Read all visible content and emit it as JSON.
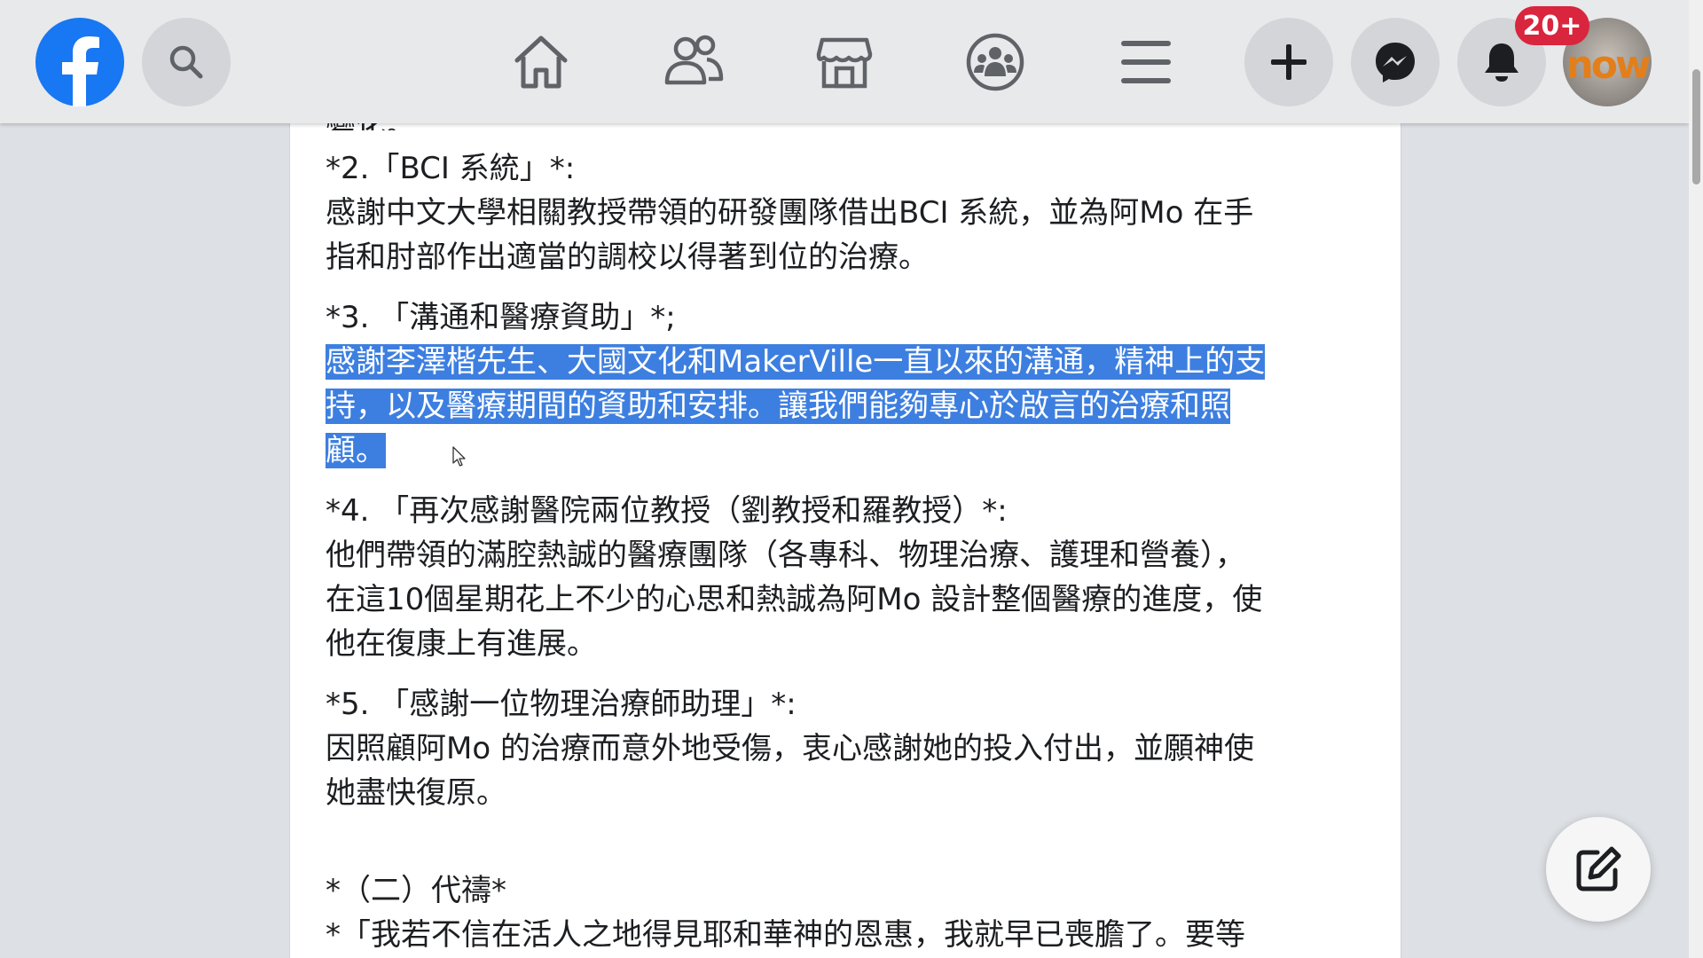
{
  "notifications": {
    "badge": "20+"
  },
  "avatar": {
    "text": "now"
  },
  "post": {
    "clipped_text": "變化。",
    "sections": [
      {
        "heading": "*2.「BCI 系統」*:",
        "body": [
          "感謝中文大學相關教授帶領的研發團隊借出BCI 系統，並為阿Mo 在手",
          "指和肘部作出適當的調校以得著到位的治療。"
        ]
      },
      {
        "heading": "*3. 「溝通和醫療資助」*;",
        "body": [
          "感謝李澤楷先生、大國文化和MakerVille一直以來的溝通，精神上的支",
          "持，以及醫療期間的資助和安排。讓我們能夠專心於啟言的治療和照",
          "顧。"
        ]
      },
      {
        "heading": "*4. 「再次感謝醫院兩位教授（劉教授和羅教授）*:",
        "body": [
          "他們帶領的滿腔熱誠的醫療團隊（各專科、物理治療、護理和營養），",
          "在這10個星期花上不少的心思和熱誠為阿Mo 設計整個醫療的進度，使",
          "他在復康上有進展。"
        ]
      },
      {
        "heading": "*5. 「感謝一位物理治療師助理」*:",
        "body": [
          "因照顧阿Mo 的治療而意外地受傷，衷心感謝她的投入付出，並願神使",
          "她盡快復原。"
        ]
      }
    ],
    "section_two_heading": "*（二）代禱*",
    "last_line": "*「我若不信在活人之地得見耶和華神的恩惠，我就早已喪膽了。要等"
  },
  "colors": {
    "fb_blue": "#1877f2",
    "badge_red": "#d9253d",
    "highlight": "#3d7fe0",
    "icon_gray": "#5f6368"
  },
  "icons": [
    "facebook-logo-icon",
    "search-icon",
    "home-icon",
    "friends-icon",
    "marketplace-icon",
    "groups-icon",
    "menu-icon",
    "plus-icon",
    "messenger-icon",
    "bell-icon",
    "compose-icon",
    "mouse-cursor-icon"
  ]
}
